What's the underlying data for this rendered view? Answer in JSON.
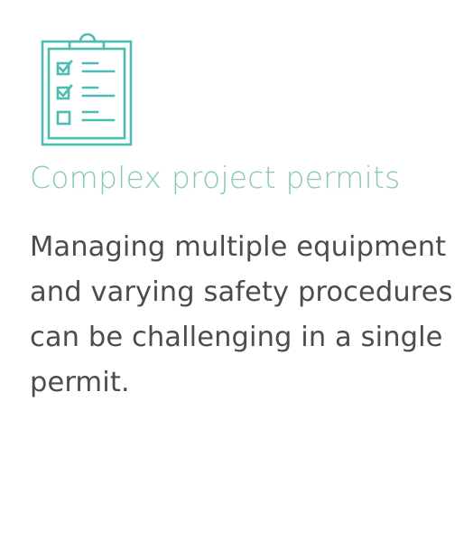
{
  "card": {
    "icon": "clipboard-checklist-icon",
    "accent_color": "#4bbdb2",
    "title_color": "#8cc7b6",
    "text_color": "#4c4c4c",
    "title": "Complex project permits",
    "description": "Managing multiple equipment and varying safety procedures can be challenging in a single permit.",
    "checklist": [
      {
        "state": "checked"
      },
      {
        "state": "checked"
      },
      {
        "state": "unchecked"
      }
    ]
  }
}
